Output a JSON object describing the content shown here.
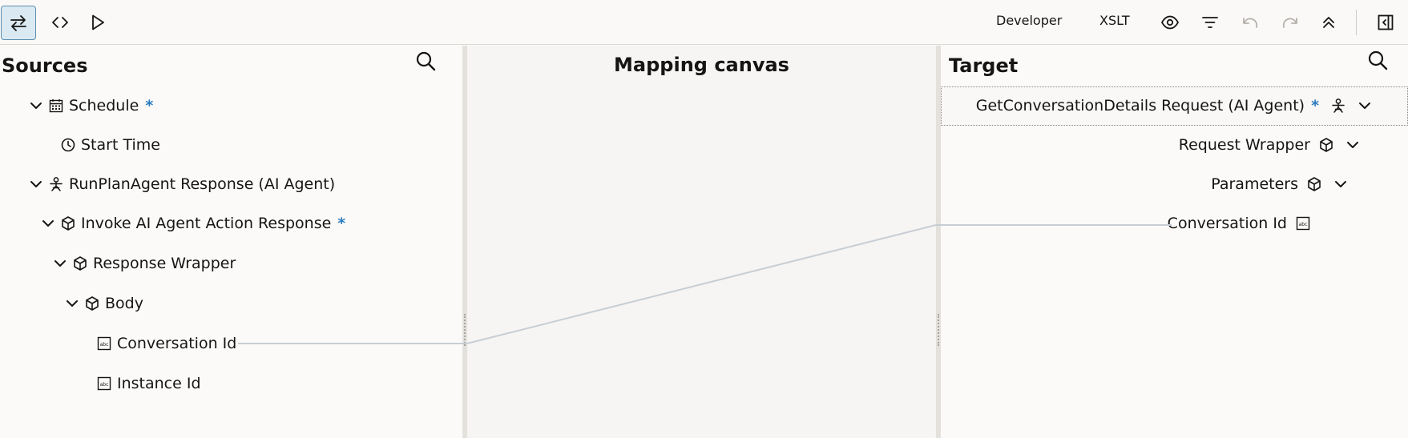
{
  "toolbar": {
    "mode_label": "Developer",
    "xslt_label": "XSLT",
    "icons": [
      "swap-icon",
      "code-icon",
      "play-icon",
      "eye-icon",
      "filter-icon",
      "undo-icon",
      "redo-icon",
      "collapse-up-icon",
      "panel-toggle-icon"
    ]
  },
  "sources": {
    "title": "Sources",
    "nodes": [
      {
        "label": "Schedule",
        "required": "*",
        "icon": "calendar-icon"
      },
      {
        "label": "Start Time",
        "icon": "clock-icon"
      },
      {
        "label": "RunPlanAgent Response (AI Agent)",
        "icon": "agent-icon"
      },
      {
        "label": "Invoke AI Agent Action Response",
        "required": "*",
        "icon": "cube-icon"
      },
      {
        "label": "Response Wrapper",
        "icon": "cube-icon"
      },
      {
        "label": "Body",
        "icon": "cube-icon"
      },
      {
        "label": "Conversation Id",
        "icon": "string-icon"
      },
      {
        "label": "Instance Id",
        "icon": "string-icon"
      }
    ]
  },
  "canvas": {
    "title": "Mapping canvas"
  },
  "target": {
    "title": "Target",
    "nodes": [
      {
        "label": "GetConversationDetails Request (AI Agent)",
        "required": "*",
        "icon": "agent-icon"
      },
      {
        "label": "Request Wrapper",
        "icon": "cube-icon"
      },
      {
        "label": "Parameters",
        "icon": "cube-icon"
      },
      {
        "label": "Conversation Id",
        "icon": "string-icon"
      }
    ]
  },
  "colors": {
    "accent": "#2b7bbf",
    "link": "#c8ced6",
    "active_bg": "#dbe9f2"
  }
}
